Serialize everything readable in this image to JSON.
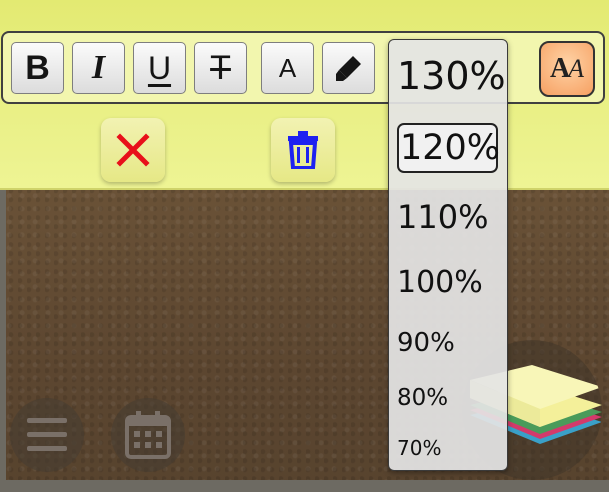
{
  "toolbar": {
    "bold_label": "B",
    "italic_label": "I",
    "underline_label": "U",
    "strikethrough_label": "T",
    "font_color_label": "A",
    "highlight_icon": "marker-icon",
    "font_size_icon": "font-size-icon"
  },
  "actions": {
    "cancel_icon": "close-icon",
    "delete_icon": "trash-icon",
    "cancel_color": "#e8101a",
    "delete_color": "#1e21f0"
  },
  "zoom_menu": {
    "options": [
      "130%",
      "120%",
      "110%",
      "100%",
      "90%",
      "80%",
      "70%"
    ],
    "selected": "120%"
  },
  "bottom_nav": {
    "menu_icon": "hamburger-menu-icon",
    "calendar_icon": "calendar-icon",
    "notes_icon": "sticky-notes-stack-icon"
  },
  "colors": {
    "panel": "#e8ee82",
    "toolbar": "#f2f6ae",
    "font_size_button": "#f6a062",
    "board": "#5c4630"
  }
}
